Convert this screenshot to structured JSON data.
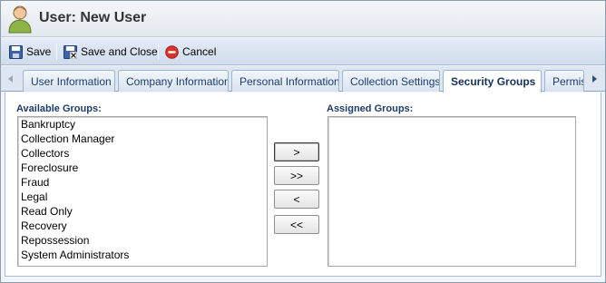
{
  "window": {
    "title": "User: New User"
  },
  "toolbar": {
    "save_label": "Save",
    "save_close_label": "Save and Close",
    "cancel_label": "Cancel"
  },
  "tabs": [
    {
      "label": "User Information",
      "active": false
    },
    {
      "label": "Company Information",
      "active": false
    },
    {
      "label": "Personal Information",
      "active": false
    },
    {
      "label": "Collection Settings",
      "active": false
    },
    {
      "label": "Security Groups",
      "active": true
    },
    {
      "label": "Permiss",
      "active": false
    }
  ],
  "available": {
    "label": "Available Groups:",
    "items": [
      "Bankruptcy",
      "Collection Manager",
      "Collectors",
      "Foreclosure",
      "Fraud",
      "Legal",
      "Read Only",
      "Recovery",
      "Repossession",
      "System Administrators"
    ]
  },
  "assigned": {
    "label": "Assigned Groups:",
    "items": []
  },
  "move_buttons": {
    "add": ">",
    "add_all": ">>",
    "remove": "<",
    "remove_all": "<<"
  },
  "colors": {
    "accent": "#1c3c6a",
    "toolbar_bg": "#cfdceb",
    "cancel_red": "#d9342b"
  },
  "icons": [
    "user-icon",
    "save-icon",
    "save-and-close-icon",
    "cancel-icon",
    "tab-scroll-left-icon",
    "tab-scroll-right-icon"
  ]
}
